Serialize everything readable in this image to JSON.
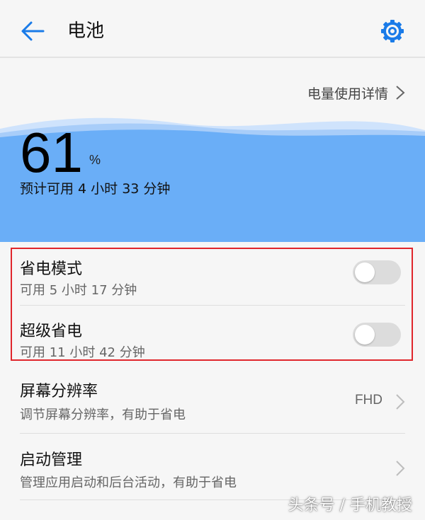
{
  "header": {
    "title": "电池",
    "back_icon": "back-arrow-icon",
    "settings_icon": "gear-icon"
  },
  "usage_detail": {
    "label": "电量使用详情",
    "icon": "chevron-right-icon"
  },
  "battery": {
    "percent": "61",
    "percent_sign": "%",
    "estimate": "预计可用 4 小时 33 分钟",
    "level": 0.61,
    "color": "#6aaef7"
  },
  "settings": [
    {
      "title": "省电模式",
      "subtitle": "可用 5 小时 17 分钟",
      "control": "toggle",
      "on": false
    },
    {
      "title": "超级省电",
      "subtitle": "可用 11 小时 42 分钟",
      "control": "toggle",
      "on": false
    },
    {
      "title": "屏幕分辨率",
      "subtitle": "调节屏幕分辨率，有助于省电",
      "value": "FHD",
      "control": "chevron"
    },
    {
      "title": "启动管理",
      "subtitle": "管理应用启动和后台活动，有助于省电",
      "control": "chevron"
    }
  ],
  "colors": {
    "accent": "#1a7be8",
    "highlight_border": "#e0262c",
    "background": "#f6f6f6"
  },
  "watermark": "头条号 / 手机教授"
}
